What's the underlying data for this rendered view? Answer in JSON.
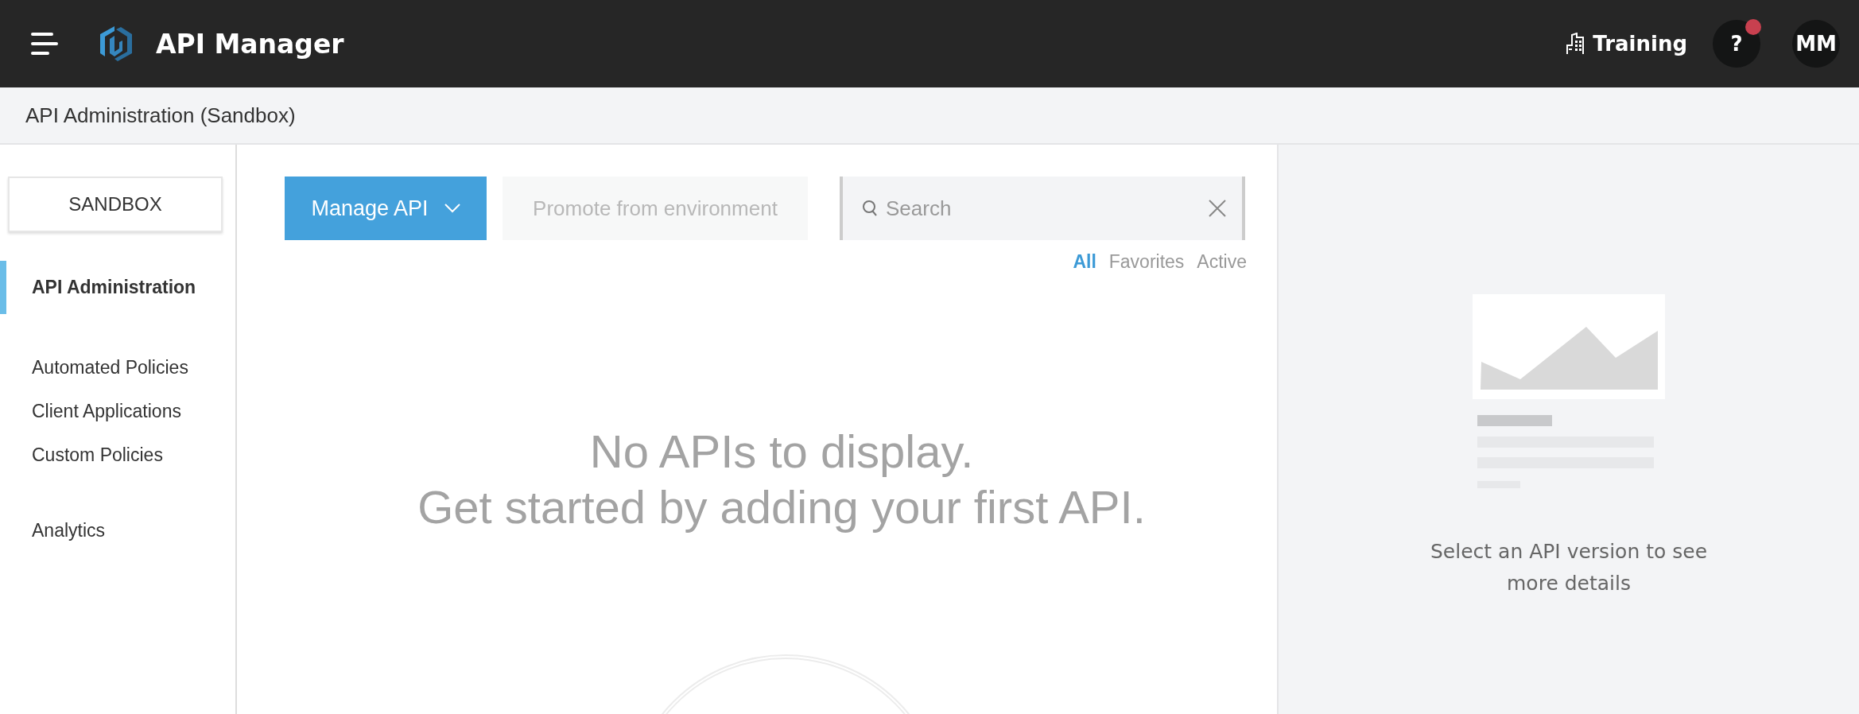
{
  "header": {
    "title": "API Manager",
    "training": "Training",
    "help": {
      "label": "?",
      "notification": true
    },
    "avatar": "MM"
  },
  "breadcrumb": "API Administration (Sandbox)",
  "sidebar": {
    "environment": "SANDBOX",
    "sections": [
      {
        "items": [
          {
            "label": "API Administration",
            "selected": true
          }
        ]
      },
      {
        "items": [
          {
            "label": "Automated Policies",
            "selected": false
          },
          {
            "label": "Client Applications",
            "selected": false
          },
          {
            "label": "Custom Policies",
            "selected": false
          }
        ]
      },
      {
        "items": [
          {
            "label": "Analytics",
            "selected": false
          }
        ]
      }
    ]
  },
  "toolbar": {
    "manage_button": "Manage API",
    "promote_button": {
      "label": "Promote from environment",
      "disabled": true
    },
    "search": {
      "placeholder": "Search"
    },
    "filters": [
      {
        "label": "All",
        "selected": true
      },
      {
        "label": "Favorites",
        "selected": false
      },
      {
        "label": "Active",
        "selected": false
      }
    ]
  },
  "empty_state": {
    "lines": [
      "No APIs to display.",
      "Get started by adding your first API."
    ]
  },
  "details_panel": {
    "message": "Select an API version to see more details"
  }
}
